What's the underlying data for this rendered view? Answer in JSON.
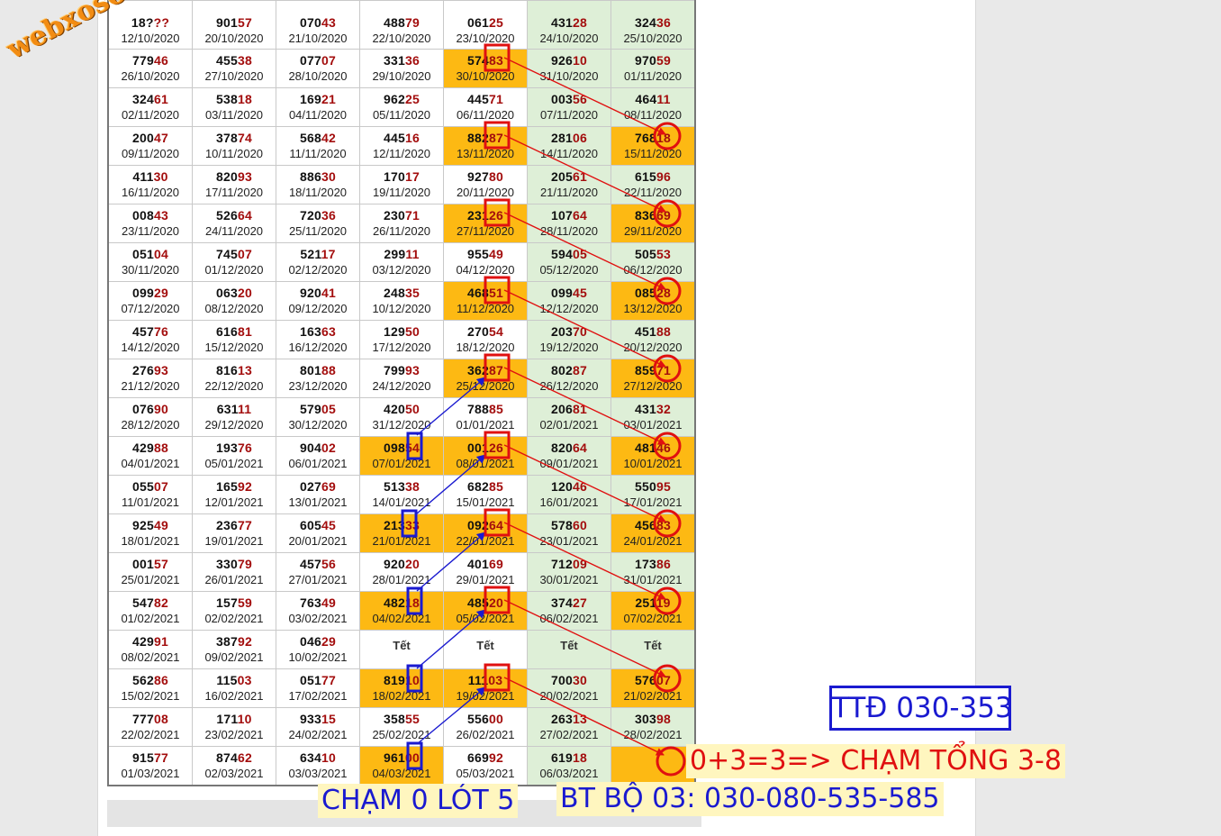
{
  "watermark": "webxoso.net",
  "notes": {
    "ttd": "TTĐ 030-353",
    "sum": "0+3=3=> CHẠM TỔNG 3-8",
    "cham": "CHẠM 0 LÓT 5",
    "bt": "BT BỘ 03: 030-080-535-585"
  },
  "colors": {
    "highlight": "#fdb913",
    "green_column": "#deefd7",
    "tail_digits": "#a30d0d",
    "red_marker": "#e01010",
    "blue_marker": "#1a1ad0"
  },
  "rows": [
    [
      [
        "18???",
        "12/10/2020"
      ],
      [
        "90157",
        "20/10/2020"
      ],
      [
        "07043",
        "21/10/2020"
      ],
      [
        "48879",
        "22/10/2020"
      ],
      [
        "06125",
        "23/10/2020"
      ],
      [
        "43128",
        "24/10/2020"
      ],
      [
        "32436",
        "25/10/2020"
      ]
    ],
    [
      [
        "77946",
        "26/10/2020"
      ],
      [
        "45538",
        "27/10/2020"
      ],
      [
        "07707",
        "28/10/2020"
      ],
      [
        "33136",
        "29/10/2020"
      ],
      [
        "57483",
        "30/10/2020"
      ],
      [
        "92610",
        "31/10/2020"
      ],
      [
        "97059",
        "01/11/2020"
      ]
    ],
    [
      [
        "32461",
        "02/11/2020"
      ],
      [
        "53818",
        "03/11/2020"
      ],
      [
        "16921",
        "04/11/2020"
      ],
      [
        "96225",
        "05/11/2020"
      ],
      [
        "44571",
        "06/11/2020"
      ],
      [
        "00356",
        "07/11/2020"
      ],
      [
        "46411",
        "08/11/2020"
      ]
    ],
    [
      [
        "20047",
        "09/11/2020"
      ],
      [
        "37874",
        "10/11/2020"
      ],
      [
        "56842",
        "11/11/2020"
      ],
      [
        "44516",
        "12/11/2020"
      ],
      [
        "88287",
        "13/11/2020"
      ],
      [
        "28106",
        "14/11/2020"
      ],
      [
        "76818",
        "15/11/2020"
      ]
    ],
    [
      [
        "41130",
        "16/11/2020"
      ],
      [
        "82093",
        "17/11/2020"
      ],
      [
        "88630",
        "18/11/2020"
      ],
      [
        "17017",
        "19/11/2020"
      ],
      [
        "92780",
        "20/11/2020"
      ],
      [
        "20561",
        "21/11/2020"
      ],
      [
        "61596",
        "22/11/2020"
      ]
    ],
    [
      [
        "00843",
        "23/11/2020"
      ],
      [
        "52664",
        "24/11/2020"
      ],
      [
        "72036",
        "25/11/2020"
      ],
      [
        "23071",
        "26/11/2020"
      ],
      [
        "23126",
        "27/11/2020"
      ],
      [
        "10764",
        "28/11/2020"
      ],
      [
        "83669",
        "29/11/2020"
      ]
    ],
    [
      [
        "05104",
        "30/11/2020"
      ],
      [
        "74507",
        "01/12/2020"
      ],
      [
        "52117",
        "02/12/2020"
      ],
      [
        "29911",
        "03/12/2020"
      ],
      [
        "95549",
        "04/12/2020"
      ],
      [
        "59405",
        "05/12/2020"
      ],
      [
        "50553",
        "06/12/2020"
      ]
    ],
    [
      [
        "09929",
        "07/12/2020"
      ],
      [
        "06320",
        "08/12/2020"
      ],
      [
        "92041",
        "09/12/2020"
      ],
      [
        "24835",
        "10/12/2020"
      ],
      [
        "46851",
        "11/12/2020"
      ],
      [
        "09945",
        "12/12/2020"
      ],
      [
        "08528",
        "13/12/2020"
      ]
    ],
    [
      [
        "45776",
        "14/12/2020"
      ],
      [
        "61681",
        "15/12/2020"
      ],
      [
        "16363",
        "16/12/2020"
      ],
      [
        "12950",
        "17/12/2020"
      ],
      [
        "27054",
        "18/12/2020"
      ],
      [
        "20370",
        "19/12/2020"
      ],
      [
        "45188",
        "20/12/2020"
      ]
    ],
    [
      [
        "27693",
        "21/12/2020"
      ],
      [
        "81613",
        "22/12/2020"
      ],
      [
        "80188",
        "23/12/2020"
      ],
      [
        "79993",
        "24/12/2020"
      ],
      [
        "36287",
        "25/12/2020"
      ],
      [
        "80287",
        "26/12/2020"
      ],
      [
        "85971",
        "27/12/2020"
      ]
    ],
    [
      [
        "07690",
        "28/12/2020"
      ],
      [
        "63111",
        "29/12/2020"
      ],
      [
        "57905",
        "30/12/2020"
      ],
      [
        "42050",
        "31/12/2020"
      ],
      [
        "78885",
        "01/01/2021"
      ],
      [
        "20681",
        "02/01/2021"
      ],
      [
        "43132",
        "03/01/2021"
      ]
    ],
    [
      [
        "42988",
        "04/01/2021"
      ],
      [
        "19376",
        "05/01/2021"
      ],
      [
        "90402",
        "06/01/2021"
      ],
      [
        "09854",
        "07/01/2021"
      ],
      [
        "00126",
        "08/01/2021"
      ],
      [
        "82064",
        "09/01/2021"
      ],
      [
        "48146",
        "10/01/2021"
      ]
    ],
    [
      [
        "05507",
        "11/01/2021"
      ],
      [
        "16592",
        "12/01/2021"
      ],
      [
        "02769",
        "13/01/2021"
      ],
      [
        "51338",
        "14/01/2021"
      ],
      [
        "68285",
        "15/01/2021"
      ],
      [
        "12046",
        "16/01/2021"
      ],
      [
        "55095",
        "17/01/2021"
      ]
    ],
    [
      [
        "92549",
        "18/01/2021"
      ],
      [
        "23677",
        "19/01/2021"
      ],
      [
        "60545",
        "20/01/2021"
      ],
      [
        "21333",
        "21/01/2021"
      ],
      [
        "09264",
        "22/01/2021"
      ],
      [
        "57860",
        "23/01/2021"
      ],
      [
        "45683",
        "24/01/2021"
      ]
    ],
    [
      [
        "00157",
        "25/01/2021"
      ],
      [
        "33079",
        "26/01/2021"
      ],
      [
        "45756",
        "27/01/2021"
      ],
      [
        "92020",
        "28/01/2021"
      ],
      [
        "40169",
        "29/01/2021"
      ],
      [
        "71209",
        "30/01/2021"
      ],
      [
        "17386",
        "31/01/2021"
      ]
    ],
    [
      [
        "54782",
        "01/02/2021"
      ],
      [
        "15759",
        "02/02/2021"
      ],
      [
        "76349",
        "03/02/2021"
      ],
      [
        "48218",
        "04/02/2021"
      ],
      [
        "48520",
        "05/02/2021"
      ],
      [
        "37427",
        "06/02/2021"
      ],
      [
        "25119",
        "07/02/2021"
      ]
    ],
    [
      [
        "42991",
        "08/02/2021"
      ],
      [
        "38792",
        "09/02/2021"
      ],
      [
        "04629",
        "10/02/2021"
      ],
      [
        "Tết",
        ""
      ],
      [
        "Tết",
        ""
      ],
      [
        "Tết",
        ""
      ],
      [
        "Tết",
        ""
      ]
    ],
    [
      [
        "56286",
        "15/02/2021"
      ],
      [
        "11503",
        "16/02/2021"
      ],
      [
        "05177",
        "17/02/2021"
      ],
      [
        "81910",
        "18/02/2021"
      ],
      [
        "11103",
        "19/02/2021"
      ],
      [
        "70030",
        "20/02/2021"
      ],
      [
        "57607",
        "21/02/2021"
      ]
    ],
    [
      [
        "77708",
        "22/02/2021"
      ],
      [
        "17110",
        "23/02/2021"
      ],
      [
        "93315",
        "24/02/2021"
      ],
      [
        "35855",
        "25/02/2021"
      ],
      [
        "55600",
        "26/02/2021"
      ],
      [
        "26313",
        "27/02/2021"
      ],
      [
        "30398",
        "28/02/2021"
      ]
    ],
    [
      [
        "91577",
        "01/03/2021"
      ],
      [
        "87462",
        "02/03/2021"
      ],
      [
        "63410",
        "03/03/2021"
      ],
      [
        "96100",
        "04/03/2021"
      ],
      [
        "66992",
        "05/03/2021"
      ],
      [
        "61918",
        "06/03/2021"
      ],
      [
        "",
        ""
      ]
    ]
  ]
}
